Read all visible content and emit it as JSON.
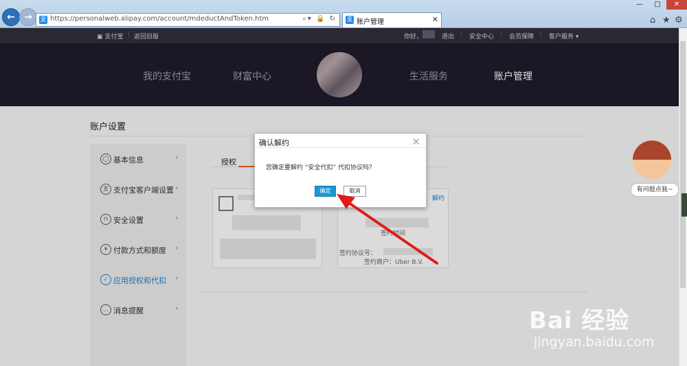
{
  "browser": {
    "url": "https://personalweb.alipay.com/account/mdeductAndToken.htm",
    "tab_title": "账户管理",
    "favicon_glyph": "支"
  },
  "topbar": {
    "logo_label": "支付宝",
    "old_version": "返回旧版",
    "greeting": "你好，",
    "logout": "退出",
    "security": "安全中心",
    "protection": "会员保障",
    "service": "客户服务 ▾"
  },
  "header": {
    "nav": [
      "我的支付宝",
      "财富中心",
      "生活服务",
      "账户管理"
    ]
  },
  "page": {
    "title": "账户设置",
    "tab_auth": "授权"
  },
  "sidebar": {
    "items": [
      {
        "label": "基本信息",
        "icon": "user-icon"
      },
      {
        "label": "支付宝客户端设置",
        "icon": "app-icon"
      },
      {
        "label": "安全设置",
        "icon": "lock-icon"
      },
      {
        "label": "付款方式和额度",
        "icon": "yen-icon"
      },
      {
        "label": "应用授权和代扣",
        "icon": "check-icon"
      },
      {
        "label": "消息提醒",
        "icon": "message-icon"
      }
    ]
  },
  "cards": {
    "unbind": "解约",
    "sign_time": "签约时间",
    "agreement_no": "签约协议号：",
    "merchant": "签约商户：Uber B.V."
  },
  "dialog": {
    "title": "确认解约",
    "message": "您确定要解约 “安全代扣” 代扣协议吗？",
    "ok": "确定",
    "cancel": "取消"
  },
  "helper": {
    "label": "有问题点我~"
  },
  "watermark": {
    "brand": "Bai 经验",
    "url": "jingyan.baidu.com"
  },
  "colors": {
    "accent": "#1a98d5",
    "arrow": "#e11a1a",
    "active_link": "#1a7fcf",
    "header_bg": "#1f1b2a"
  }
}
